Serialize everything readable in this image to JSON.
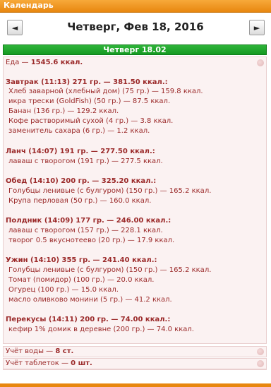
{
  "window": {
    "title": "Календарь"
  },
  "nav": {
    "prev_glyph": "◄",
    "next_glyph": "►",
    "date_title": "Четверг, Фев 18, 2016"
  },
  "day_header": "Четверг 18.02",
  "food": {
    "total_label": "Еда — ",
    "total_value": "1545.6 ккал.",
    "meals": [
      {
        "header": "Завтрак (11:13) 271 гр. — 381.50 ккал.:",
        "items": [
          "Хлеб заварной (хлебный дом) (75 гр.) — 159.8 ккал.",
          "икра трески (GoldFish) (50 гр.) — 87.5 ккал.",
          "Банан (136 гр.) — 129.2 ккал.",
          "Кофе растворимый сухой (4 гр.) — 3.8 ккал.",
          "заменитель сахара (6 гр.) — 1.2 ккал."
        ]
      },
      {
        "header": "Ланч (14:07) 191 гр. — 277.50 ккал.:",
        "items": [
          "лаваш с творогом (191 гр.) — 277.5 ккал."
        ]
      },
      {
        "header": "Обед (14:10) 200 гр. — 325.20 ккал.:",
        "items": [
          "Голубцы ленивые (с булгуром) (150 гр.) — 165.2 ккал.",
          "Крупа перловая (50 гр.) — 160.0 ккал."
        ]
      },
      {
        "header": "Полдник (14:09) 177 гр. — 246.00 ккал.:",
        "items": [
          "лаваш с творогом (157 гр.) — 228.1 ккал.",
          "творог 0.5 вкуснотеево (20 гр.) — 17.9 ккал."
        ]
      },
      {
        "header": "Ужин (14:10) 355 гр. — 241.40 ккал.:",
        "items": [
          "Голубцы ленивые (с булгуром) (150 гр.) — 165.2 ккал.",
          "Томат (помидор) (100 гр.) — 20.0 ккал.",
          "Огурец (100 гр.) — 15.0 ккал.",
          "масло оливково монини (5 гр.) — 41.2 ккал."
        ]
      },
      {
        "header": "Перекусы (14:11) 200 гр. — 74.00 ккал.:",
        "items": [
          "кефир 1% домик в деревне (200 гр.) — 74.0 ккал."
        ]
      }
    ]
  },
  "water": {
    "label": "Учёт воды — ",
    "value": "8 ст."
  },
  "pills": {
    "label": "Учёт таблеток — ",
    "value": "0 шт."
  },
  "colors": {
    "accent_orange": "#e8870f",
    "day_green": "#1aa526",
    "text_red": "#9b2a2a"
  }
}
